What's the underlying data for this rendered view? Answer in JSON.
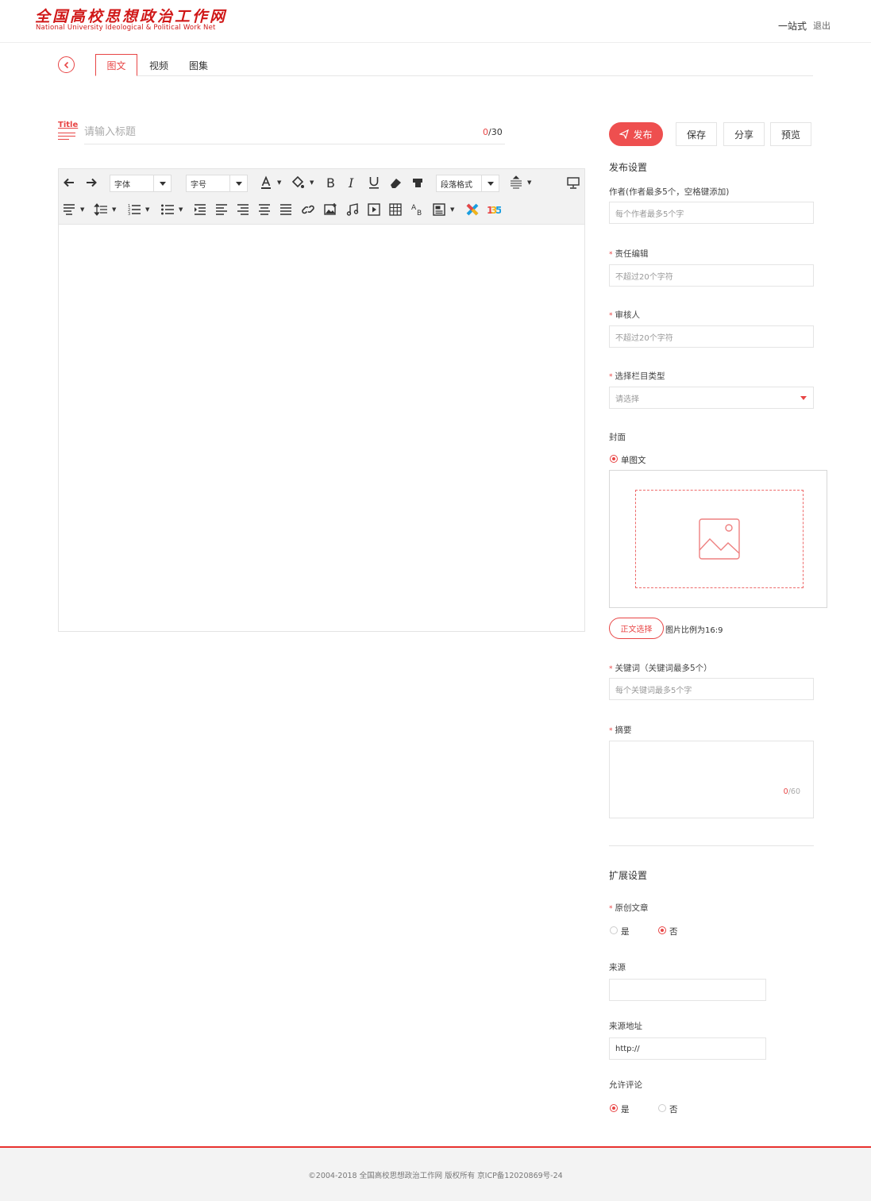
{
  "header": {
    "logo_cn": "全国高校思想政治工作网",
    "logo_en": "National University Ideological & Political Work Net",
    "onestop": "一站式",
    "logout": "退出"
  },
  "tabs": [
    "图文",
    "视频",
    "图集"
  ],
  "title": {
    "icon_text": "Title",
    "placeholder": "请输入标题",
    "count_current": "0",
    "count_max": "/30"
  },
  "toolbar": {
    "font_label": "字体",
    "size_label": "字号",
    "paragraph_label": "段落格式"
  },
  "actions": {
    "publish": "发布",
    "save": "保存",
    "share": "分享",
    "preview": "预览"
  },
  "publish_settings": {
    "title": "发布设置",
    "author_label": "作者(作者最多5个，空格键添加)",
    "author_placeholder": "每个作者最多5个字",
    "editor_label": "责任编辑",
    "editor_placeholder": "不超过20个字符",
    "reviewer_label": "审核人",
    "reviewer_placeholder": "不超过20个字符",
    "column_label": "选择栏目类型",
    "column_placeholder": "请选择",
    "cover_label": "封面",
    "cover_option": "单图文",
    "custom_button": "正文选择",
    "ratio_text": "图片比例为16:9",
    "keywords_label": "关键词（关键词最多5个）",
    "keywords_placeholder": "每个关键词最多5个字",
    "summary_label": "摘要",
    "summary_count_current": "0",
    "summary_count_max": "/60"
  },
  "extend_settings": {
    "title": "扩展设置",
    "original_label": "原创文章",
    "yes": "是",
    "no": "否",
    "source_label": "来源",
    "source_url_label": "来源地址",
    "source_url_value": "http://",
    "comment_label": "允许评论"
  },
  "colors": {
    "accent": "#e84545",
    "logo": "#d01818"
  },
  "footer": {
    "copyright": "©2004-2018 全国高校思想政治工作网 版权所有 京ICP备12020869号-24"
  }
}
